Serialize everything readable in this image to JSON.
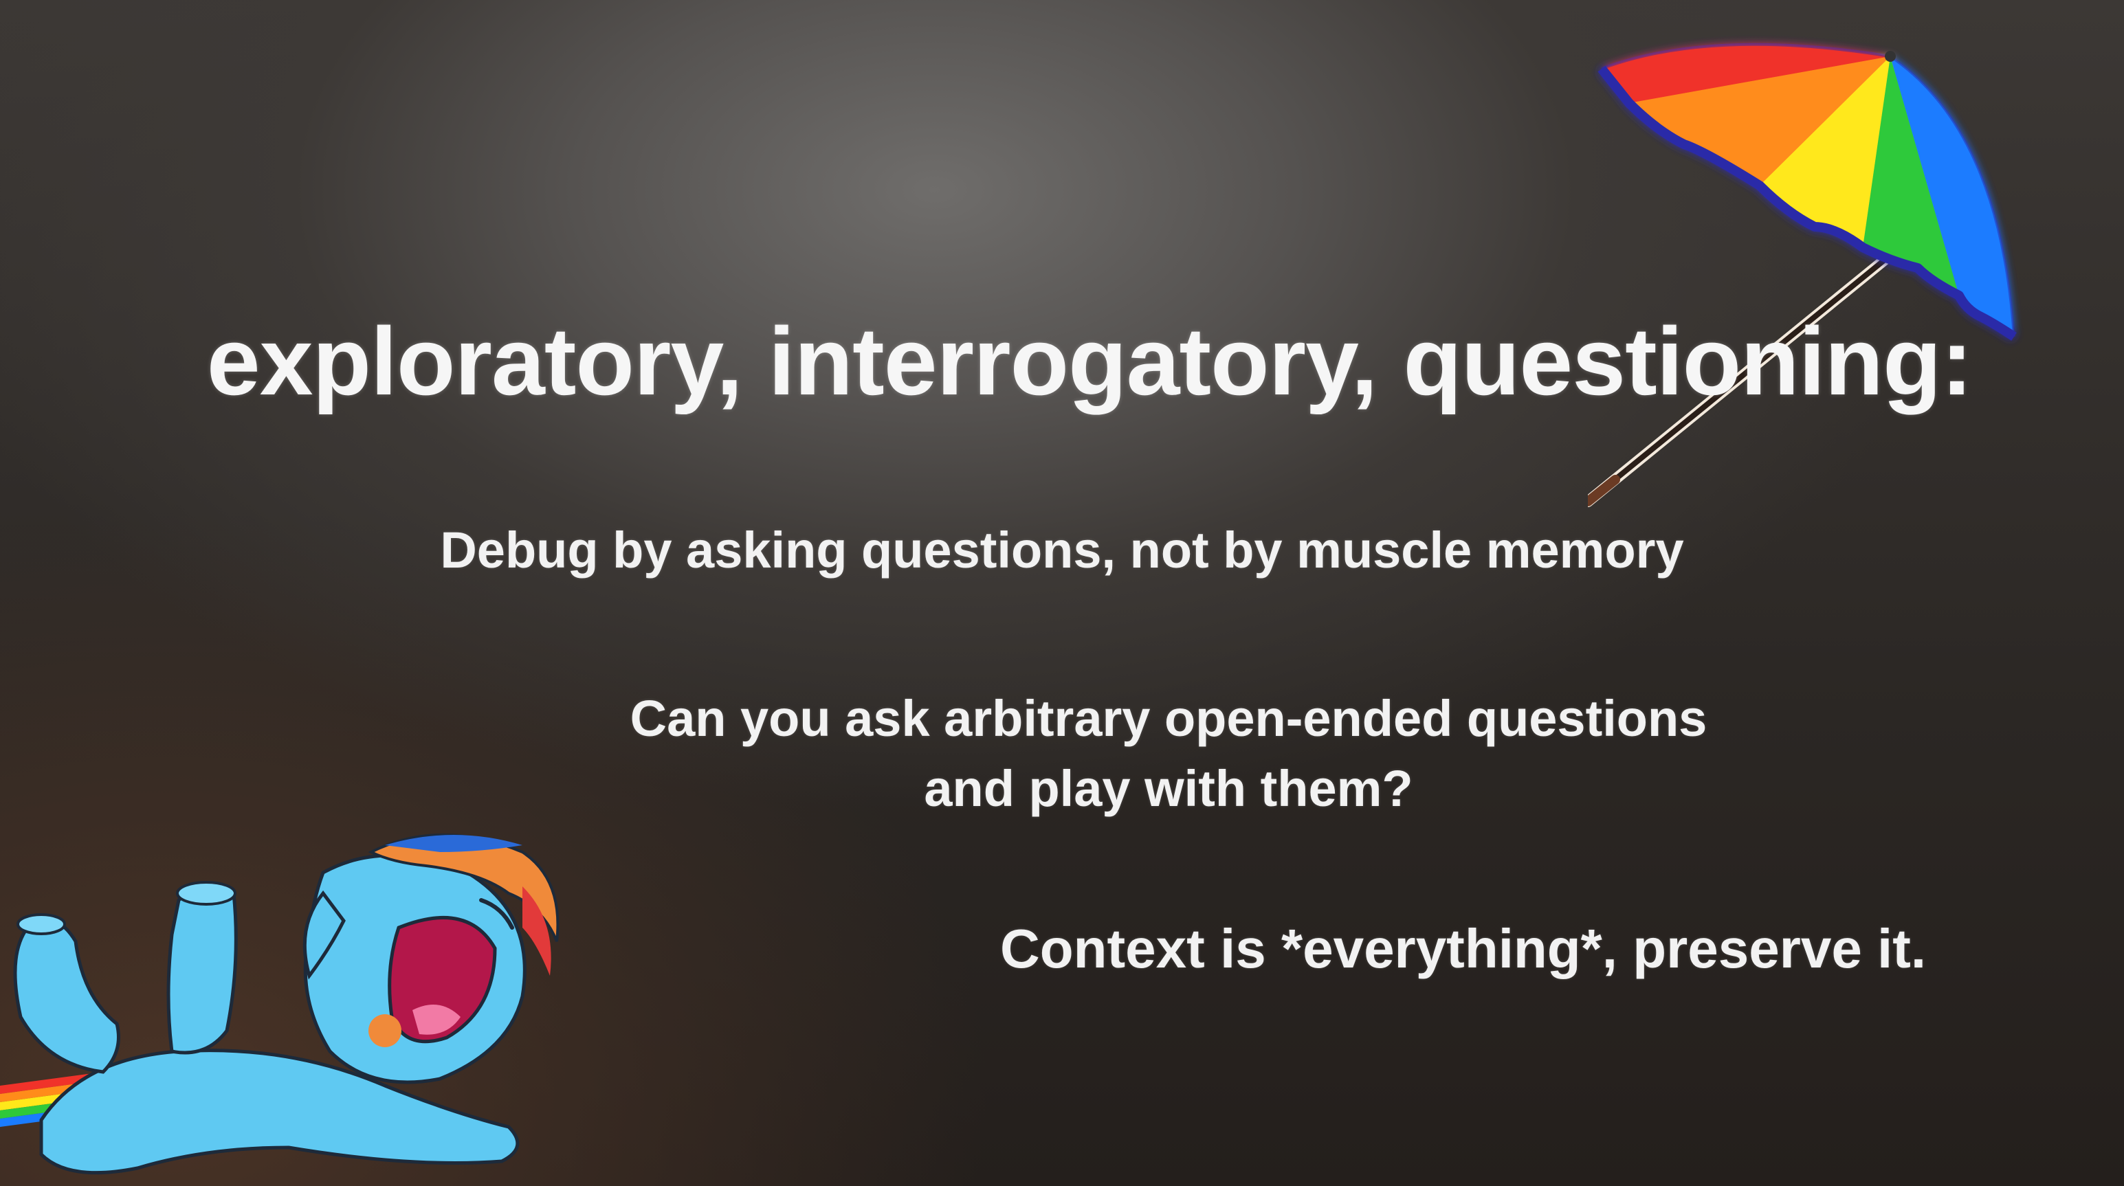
{
  "slide": {
    "title": "exploratory, interrogatory, questioning:",
    "lines": {
      "debug": "Debug by asking questions, not by muscle memory",
      "question_1": "Can you ask arbitrary open-ended questions",
      "question_2": "and play with them?",
      "context": "Context is *everything*, preserve it."
    },
    "decorations": {
      "top_right": "umbrella-icon",
      "bottom_left": "pony-illustration"
    },
    "colors": {
      "background": "#3c3835",
      "text": "#f2f2f2",
      "umbrella_red": "#f0322a",
      "umbrella_orange": "#ff8c1a",
      "umbrella_yellow": "#ffe81a",
      "umbrella_green": "#2fc93a",
      "umbrella_blue": "#1a7cff",
      "umbrella_edge": "#2a2aa8",
      "pony_body": "#5fc9f2",
      "pony_mane_orange": "#f08a3a",
      "pony_mouth": "#b3174a"
    }
  }
}
